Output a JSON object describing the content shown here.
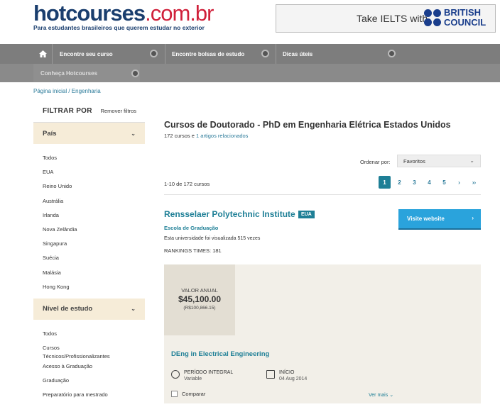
{
  "header": {
    "logo_main": "hotcourses",
    "logo_domain": ".com.br",
    "logo_tagline": "Para estudantes brasileiros que querem estudar no exterior",
    "ad_text": "Take IELTS with",
    "ad_brand_line1": "BRITISH",
    "ad_brand_line2": "COUNCIL"
  },
  "nav": {
    "items": [
      "Encontre seu curso",
      "Encontre bolsas de estudo",
      "Dicas úteis"
    ],
    "row2_item": "Conheça Hotcourses"
  },
  "breadcrumb": "Página inicial / Engenharia",
  "sidebar": {
    "title": "FILTRAR POR",
    "remove": "Remover filtros",
    "country_section": "País",
    "countries": [
      "Todos",
      "EUA",
      "Reino Unido",
      "Austrália",
      "Irlanda",
      "Nova Zelândia",
      "Singapura",
      "Suécia",
      "Malásia",
      "Hong Kong"
    ],
    "level_section": "Nível de estudo",
    "levels": [
      "Todos",
      "Cursos",
      "Técnicos/Profissionalizantes",
      "Acesso à Graduação",
      "Graduação",
      "Preparatório para mestrado"
    ]
  },
  "main": {
    "title": "Cursos de Doutorado - PhD em Engenharia Elétrica Estados Unidos",
    "counts_prefix": "172 cursos e",
    "counts_link": "1 artigos relacionados",
    "order_label": "Ordenar por:",
    "order_value": "Favoritos",
    "range": "1-10 de 172 cursos",
    "pages": [
      "1",
      "2",
      "3",
      "4",
      "5",
      "›",
      "››"
    ]
  },
  "result": {
    "institution": "Rensselaer Polytechnic Institute",
    "country_badge": "EUA",
    "school": "Escola de Graduação",
    "views": "Esta universidade foi visualizada 515 vezes",
    "rankings": "RANKINGS TIMES: 181",
    "visit_button": "Visite website",
    "price_label": "VALOR ANUAL",
    "price_value": "$45,100.00",
    "price_sub": "(R$100,866.15)",
    "course_title": "DEng in Electrical Engineering",
    "mode_label": "PERÍODO INTEGRAL",
    "mode_sub": "Variable",
    "start_label": "INÍCIO",
    "start_date": "04 Aug 2014",
    "compare": "Comparar",
    "more": "Ver mais"
  }
}
